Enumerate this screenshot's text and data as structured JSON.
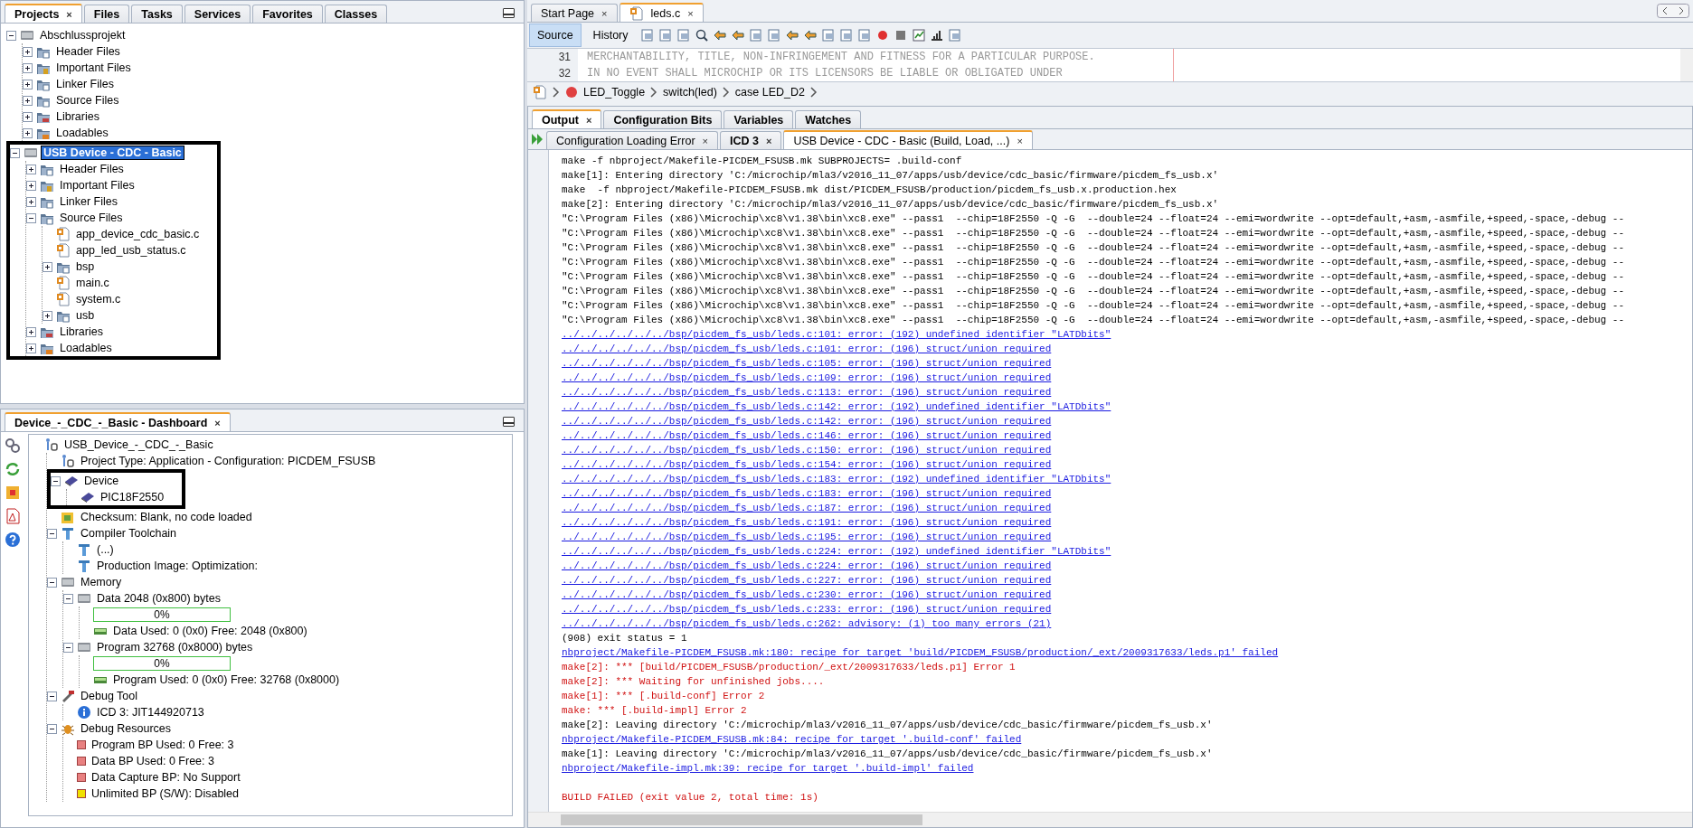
{
  "projects_panel": {
    "tabs": [
      {
        "label": "Projects",
        "selected": true,
        "close": "×"
      },
      {
        "label": "Files",
        "selected": false
      },
      {
        "label": "Tasks",
        "selected": false
      },
      {
        "label": "Services",
        "selected": false
      },
      {
        "label": "Favorites",
        "selected": false
      },
      {
        "label": "Classes",
        "selected": false
      }
    ],
    "tree": [
      {
        "label": "Abschlussprojekt",
        "kind": "project",
        "expanded": true,
        "selected": false,
        "children": [
          {
            "label": "Header Files",
            "kind": "folder",
            "expanded": false,
            "selected": false
          },
          {
            "label": "Important Files",
            "kind": "important",
            "expanded": false,
            "selected": false
          },
          {
            "label": "Linker Files",
            "kind": "folder",
            "expanded": false,
            "selected": false
          },
          {
            "label": "Source Files",
            "kind": "folder",
            "expanded": false,
            "selected": false
          },
          {
            "label": "Libraries",
            "kind": "library",
            "expanded": false,
            "selected": false
          },
          {
            "label": "Loadables",
            "kind": "loadable",
            "expanded": false,
            "selected": false
          }
        ]
      },
      {
        "label": "USB Device - CDC - Basic",
        "kind": "project",
        "expanded": true,
        "selected": true,
        "boxed": true,
        "children": [
          {
            "label": "Header Files",
            "kind": "folder",
            "expanded": false,
            "selected": false
          },
          {
            "label": "Important Files",
            "kind": "important",
            "expanded": false,
            "selected": false
          },
          {
            "label": "Linker Files",
            "kind": "folder",
            "expanded": false,
            "selected": false
          },
          {
            "label": "Source Files",
            "kind": "folder",
            "expanded": true,
            "selected": false,
            "children": [
              {
                "label": "app_device_cdc_basic.c",
                "kind": "cfile",
                "selected": false
              },
              {
                "label": "app_led_usb_status.c",
                "kind": "cfile",
                "selected": false
              },
              {
                "label": "bsp",
                "kind": "folder",
                "expanded": false,
                "selected": false
              },
              {
                "label": "main.c",
                "kind": "cfile",
                "selected": false
              },
              {
                "label": "system.c",
                "kind": "cfile",
                "selected": false
              },
              {
                "label": "usb",
                "kind": "folder",
                "expanded": false,
                "selected": false
              }
            ]
          },
          {
            "label": "Libraries",
            "kind": "library",
            "expanded": false,
            "selected": false
          },
          {
            "label": "Loadables",
            "kind": "loadable",
            "expanded": false,
            "selected": false
          }
        ]
      }
    ]
  },
  "dashboard": {
    "title": "Device_-_CDC_-_Basic - Dashboard",
    "close": "×",
    "tree": [
      {
        "label": "USB_Device_-_CDC_-_Basic",
        "kind": "config",
        "children": [
          {
            "label": "Project Type: Application - Configuration: PICDEM_FSUSB",
            "kind": "config"
          },
          {
            "label": "Device",
            "kind": "chip",
            "expanded": true,
            "boxed": true,
            "children": [
              {
                "label": "PIC18F2550",
                "kind": "chip"
              }
            ]
          },
          {
            "label": "Checksum: Blank, no code loaded",
            "kind": "checksum"
          },
          {
            "label": "Compiler Toolchain",
            "kind": "tool",
            "expanded": true,
            "children": [
              {
                "label": "(...)",
                "kind": "tool"
              },
              {
                "label": "Production Image: Optimization:",
                "kind": "tool"
              }
            ]
          },
          {
            "label": "Memory",
            "kind": "memory",
            "expanded": true,
            "children": [
              {
                "label": "Data 2048 (0x800) bytes",
                "kind": "memory",
                "expanded": true,
                "children": [
                  {
                    "label": "0%",
                    "kind": "progress",
                    "level": 0
                  },
                  {
                    "label": "Data Used: 0 (0x0) Free: 2048 (0x800)",
                    "kind": "ram"
                  }
                ]
              },
              {
                "label": "Program 32768 (0x8000) bytes",
                "kind": "memory",
                "expanded": true,
                "children": [
                  {
                    "label": "0%",
                    "kind": "progress",
                    "level": 0
                  },
                  {
                    "label": "Program Used: 0 (0x0) Free: 32768 (0x8000)",
                    "kind": "ram"
                  }
                ]
              }
            ]
          },
          {
            "label": "Debug Tool",
            "kind": "debugtool",
            "expanded": true,
            "children": [
              {
                "label": "ICD 3: JIT144920713",
                "kind": "info"
              }
            ]
          },
          {
            "label": "Debug Resources",
            "kind": "bug",
            "expanded": true,
            "children": [
              {
                "label": "Program BP Used: 0  Free: 3",
                "kind": "bp",
                "color": "#e88080"
              },
              {
                "label": "Data BP Used: 0  Free: 3",
                "kind": "bp",
                "color": "#e88080"
              },
              {
                "label": "Data Capture BP: No Support",
                "kind": "bp",
                "color": "#e88080"
              },
              {
                "label": "Unlimited BP (S/W): Disabled",
                "kind": "bp",
                "color": "#f0e000"
              }
            ]
          }
        ]
      }
    ]
  },
  "editor": {
    "tabs": [
      {
        "label": "Start Page",
        "selected": false,
        "close": "×"
      },
      {
        "label": "leds.c",
        "selected": true,
        "close": "×"
      }
    ],
    "modes": [
      {
        "label": "Source",
        "selected": true
      },
      {
        "label": "History",
        "selected": false
      }
    ],
    "code": [
      {
        "number": "31",
        "text": "MERCHANTABILITY, TITLE, NON-INFRINGEMENT AND FITNESS FOR A PARTICULAR PURPOSE."
      },
      {
        "number": "32",
        "text": "IN NO EVENT SHALL MICROCHIP OR ITS LICENSORS BE LIABLE OR OBLIGATED UNDER"
      }
    ],
    "breadcrumb": [
      "LED_Toggle",
      "switch(led)",
      "case LED_D2"
    ]
  },
  "output_panel": {
    "tabs": [
      {
        "label": "Output",
        "selected": true,
        "close": "×"
      },
      {
        "label": "Configuration Bits",
        "selected": false
      },
      {
        "label": "Variables",
        "selected": false
      },
      {
        "label": "Watches",
        "selected": false
      }
    ],
    "subtabs": [
      {
        "label": "Configuration Loading Error",
        "selected": false,
        "bold": false,
        "close": "×"
      },
      {
        "label": "ICD 3",
        "selected": false,
        "bold": true,
        "close": "×"
      },
      {
        "label": "USB Device - CDC - Basic (Build, Load, ...)",
        "selected": true,
        "bold": false,
        "close": "×"
      }
    ],
    "lines": [
      {
        "kind": "plain",
        "text": "make -f nbproject/Makefile-PICDEM_FSUSB.mk SUBPROJECTS= .build-conf"
      },
      {
        "kind": "plain",
        "text": "make[1]: Entering directory 'C:/microchip/mla3/v2016_11_07/apps/usb/device/cdc_basic/firmware/picdem_fs_usb.x'"
      },
      {
        "kind": "plain",
        "text": "make  -f nbproject/Makefile-PICDEM_FSUSB.mk dist/PICDEM_FSUSB/production/picdem_fs_usb.x.production.hex"
      },
      {
        "kind": "plain",
        "text": "make[2]: Entering directory 'C:/microchip/mla3/v2016_11_07/apps/usb/device/cdc_basic/firmware/picdem_fs_usb.x'"
      },
      {
        "kind": "plain",
        "text": "\"C:\\Program Files (x86)\\Microchip\\xc8\\v1.38\\bin\\xc8.exe\" --pass1  --chip=18F2550 -Q -G  --double=24 --float=24 --emi=wordwrite --opt=default,+asm,-asmfile,+speed,-space,-debug --"
      },
      {
        "kind": "plain",
        "text": "\"C:\\Program Files (x86)\\Microchip\\xc8\\v1.38\\bin\\xc8.exe\" --pass1  --chip=18F2550 -Q -G  --double=24 --float=24 --emi=wordwrite --opt=default,+asm,-asmfile,+speed,-space,-debug --"
      },
      {
        "kind": "plain",
        "text": "\"C:\\Program Files (x86)\\Microchip\\xc8\\v1.38\\bin\\xc8.exe\" --pass1  --chip=18F2550 -Q -G  --double=24 --float=24 --emi=wordwrite --opt=default,+asm,-asmfile,+speed,-space,-debug --"
      },
      {
        "kind": "plain",
        "text": "\"C:\\Program Files (x86)\\Microchip\\xc8\\v1.38\\bin\\xc8.exe\" --pass1  --chip=18F2550 -Q -G  --double=24 --float=24 --emi=wordwrite --opt=default,+asm,-asmfile,+speed,-space,-debug --"
      },
      {
        "kind": "plain",
        "text": "\"C:\\Program Files (x86)\\Microchip\\xc8\\v1.38\\bin\\xc8.exe\" --pass1  --chip=18F2550 -Q -G  --double=24 --float=24 --emi=wordwrite --opt=default,+asm,-asmfile,+speed,-space,-debug --"
      },
      {
        "kind": "plain",
        "text": "\"C:\\Program Files (x86)\\Microchip\\xc8\\v1.38\\bin\\xc8.exe\" --pass1  --chip=18F2550 -Q -G  --double=24 --float=24 --emi=wordwrite --opt=default,+asm,-asmfile,+speed,-space,-debug --"
      },
      {
        "kind": "plain",
        "text": "\"C:\\Program Files (x86)\\Microchip\\xc8\\v1.38\\bin\\xc8.exe\" --pass1  --chip=18F2550 -Q -G  --double=24 --float=24 --emi=wordwrite --opt=default,+asm,-asmfile,+speed,-space,-debug --"
      },
      {
        "kind": "plain",
        "text": "\"C:\\Program Files (x86)\\Microchip\\xc8\\v1.38\\bin\\xc8.exe\" --pass1  --chip=18F2550 -Q -G  --double=24 --float=24 --emi=wordwrite --opt=default,+asm,-asmfile,+speed,-space,-debug --"
      },
      {
        "kind": "link",
        "text": "../../../../../../bsp/picdem_fs_usb/leds.c:101: error: (192) undefined identifier \"LATDbits\""
      },
      {
        "kind": "link",
        "text": "../../../../../../bsp/picdem_fs_usb/leds.c:101: error: (196) struct/union required"
      },
      {
        "kind": "link",
        "text": "../../../../../../bsp/picdem_fs_usb/leds.c:105: error: (196) struct/union required"
      },
      {
        "kind": "link",
        "text": "../../../../../../bsp/picdem_fs_usb/leds.c:109: error: (196) struct/union required"
      },
      {
        "kind": "link",
        "text": "../../../../../../bsp/picdem_fs_usb/leds.c:113: error: (196) struct/union required"
      },
      {
        "kind": "link",
        "text": "../../../../../../bsp/picdem_fs_usb/leds.c:142: error: (192) undefined identifier \"LATDbits\""
      },
      {
        "kind": "link",
        "text": "../../../../../../bsp/picdem_fs_usb/leds.c:142: error: (196) struct/union required"
      },
      {
        "kind": "link",
        "text": "../../../../../../bsp/picdem_fs_usb/leds.c:146: error: (196) struct/union required"
      },
      {
        "kind": "link",
        "text": "../../../../../../bsp/picdem_fs_usb/leds.c:150: error: (196) struct/union required"
      },
      {
        "kind": "link",
        "text": "../../../../../../bsp/picdem_fs_usb/leds.c:154: error: (196) struct/union required"
      },
      {
        "kind": "link",
        "text": "../../../../../../bsp/picdem_fs_usb/leds.c:183: error: (192) undefined identifier \"LATDbits\""
      },
      {
        "kind": "link",
        "text": "../../../../../../bsp/picdem_fs_usb/leds.c:183: error: (196) struct/union required"
      },
      {
        "kind": "link",
        "text": "../../../../../../bsp/picdem_fs_usb/leds.c:187: error: (196) struct/union required"
      },
      {
        "kind": "link",
        "text": "../../../../../../bsp/picdem_fs_usb/leds.c:191: error: (196) struct/union required"
      },
      {
        "kind": "link",
        "text": "../../../../../../bsp/picdem_fs_usb/leds.c:195: error: (196) struct/union required"
      },
      {
        "kind": "link",
        "text": "../../../../../../bsp/picdem_fs_usb/leds.c:224: error: (192) undefined identifier \"LATDbits\""
      },
      {
        "kind": "link",
        "text": "../../../../../../bsp/picdem_fs_usb/leds.c:224: error: (196) struct/union required"
      },
      {
        "kind": "link",
        "text": "../../../../../../bsp/picdem_fs_usb/leds.c:227: error: (196) struct/union required"
      },
      {
        "kind": "link",
        "text": "../../../../../../bsp/picdem_fs_usb/leds.c:230: error: (196) struct/union required"
      },
      {
        "kind": "link",
        "text": "../../../../../../bsp/picdem_fs_usb/leds.c:233: error: (196) struct/union required"
      },
      {
        "kind": "link",
        "text": "../../../../../../bsp/picdem_fs_usb/leds.c:262: advisory: (1) too many errors (21)"
      },
      {
        "kind": "plain",
        "text": "(908) exit status = 1"
      },
      {
        "kind": "link",
        "text": "nbproject/Makefile-PICDEM_FSUSB.mk:180: recipe for target 'build/PICDEM_FSUSB/production/_ext/2009317633/leds.p1' failed"
      },
      {
        "kind": "error",
        "text": "make[2]: *** [build/PICDEM_FSUSB/production/_ext/2009317633/leds.p1] Error 1"
      },
      {
        "kind": "error",
        "text": "make[2]: *** Waiting for unfinished jobs...."
      },
      {
        "kind": "error",
        "text": "make[1]: *** [.build-conf] Error 2"
      },
      {
        "kind": "error",
        "text": "make: *** [.build-impl] Error 2"
      },
      {
        "kind": "plain",
        "text": "make[2]: Leaving directory 'C:/microchip/mla3/v2016_11_07/apps/usb/device/cdc_basic/firmware/picdem_fs_usb.x'"
      },
      {
        "kind": "link",
        "text": "nbproject/Makefile-PICDEM_FSUSB.mk:84: recipe for target '.build-conf' failed"
      },
      {
        "kind": "plain",
        "text": "make[1]: Leaving directory 'C:/microchip/mla3/v2016_11_07/apps/usb/device/cdc_basic/firmware/picdem_fs_usb.x'"
      },
      {
        "kind": "link",
        "text": "nbproject/Makefile-impl.mk:39: recipe for target '.build-impl' failed"
      },
      {
        "kind": "error",
        "text": "BUILD FAILED (exit value 2, total time: 1s)",
        "spaced": true
      }
    ]
  }
}
